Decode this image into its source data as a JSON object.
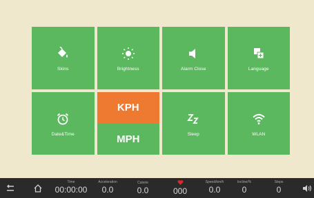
{
  "tiles": {
    "skins": {
      "label": "Skins",
      "icon": "paint-bucket-icon"
    },
    "brightness": {
      "label": "Brightness",
      "icon": "sun-icon"
    },
    "alarm_close": {
      "label": "Alarm Close",
      "icon": "speaker-icon"
    },
    "language": {
      "label": "Language",
      "icon": "translate-icon"
    },
    "datetime": {
      "label": "Date&Time",
      "icon": "alarm-clock-icon"
    },
    "unit": {
      "kph": "KPH",
      "mph": "MPH",
      "selected": "KPH"
    },
    "sleep": {
      "label": "Sleep",
      "icon": "sleep-zz-icon"
    },
    "wlan": {
      "label": "WLAN",
      "icon": "wifi-icon"
    }
  },
  "status_bar": {
    "time": {
      "label": "Time",
      "value": "00:00:00"
    },
    "acceleration": {
      "label": "Acceleration",
      "value": "0.0"
    },
    "calorie": {
      "label": "Calorie",
      "value": "0.0"
    },
    "heart": {
      "label": "",
      "value": "000"
    },
    "speed": {
      "label": "Speed/km/h",
      "value": "0.0"
    },
    "incline": {
      "label": "Incline/%",
      "value": "0"
    },
    "steps": {
      "label": "Steps",
      "value": "0"
    }
  },
  "colors": {
    "tile": "#5cb85f",
    "active": "#ee7a32",
    "bar": "#2a2a2a",
    "background": "#f0e8cd",
    "heart": "#e0282d"
  }
}
